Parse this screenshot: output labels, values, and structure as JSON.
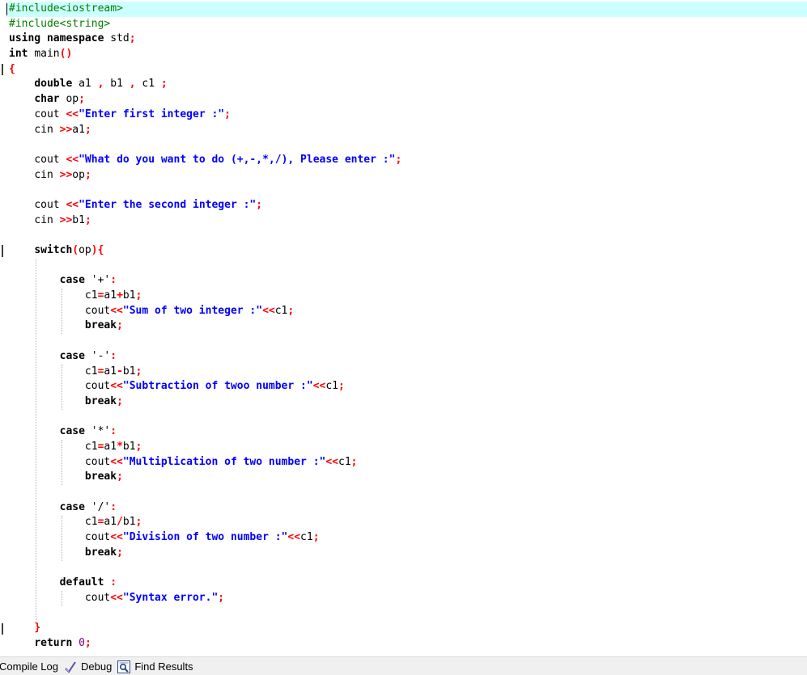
{
  "editor": {
    "lines": [
      [
        [
          "pp",
          "#include<iostream>"
        ]
      ],
      [
        [
          "pp",
          "#include<string>"
        ]
      ],
      [
        [
          "kw",
          "using"
        ],
        [
          "sp",
          " "
        ],
        [
          "kw",
          "namespace"
        ],
        [
          "sp",
          " "
        ],
        [
          "id",
          "std"
        ],
        [
          "sym",
          ";"
        ]
      ],
      [
        [
          "kw",
          "int"
        ],
        [
          "sp",
          " "
        ],
        [
          "id",
          "main"
        ],
        [
          "sym",
          "()"
        ]
      ],
      [
        [
          "sym",
          "{"
        ]
      ],
      [
        [
          "sp",
          "    "
        ],
        [
          "kw",
          "double"
        ],
        [
          "sp",
          " "
        ],
        [
          "id",
          "a1"
        ],
        [
          "sp",
          " "
        ],
        [
          "sym",
          ","
        ],
        [
          "sp",
          " "
        ],
        [
          "id",
          "b1"
        ],
        [
          "sp",
          " "
        ],
        [
          "sym",
          ","
        ],
        [
          "sp",
          " "
        ],
        [
          "id",
          "c1"
        ],
        [
          "sp",
          " "
        ],
        [
          "sym",
          ";"
        ]
      ],
      [
        [
          "sp",
          "    "
        ],
        [
          "kw",
          "char"
        ],
        [
          "sp",
          " "
        ],
        [
          "id",
          "op"
        ],
        [
          "sym",
          ";"
        ]
      ],
      [
        [
          "sp",
          "    "
        ],
        [
          "id",
          "cout"
        ],
        [
          "sp",
          " "
        ],
        [
          "sym",
          "<<"
        ],
        [
          "str",
          "\"Enter first integer :\""
        ],
        [
          "sym",
          ";"
        ]
      ],
      [
        [
          "sp",
          "    "
        ],
        [
          "id",
          "cin"
        ],
        [
          "sp",
          " "
        ],
        [
          "sym",
          ">>"
        ],
        [
          "id",
          "a1"
        ],
        [
          "sym",
          ";"
        ]
      ],
      [],
      [
        [
          "sp",
          "    "
        ],
        [
          "id",
          "cout"
        ],
        [
          "sp",
          " "
        ],
        [
          "sym",
          "<<"
        ],
        [
          "str",
          "\"What do you want to do (+,-,*,/), Please enter :\""
        ],
        [
          "sym",
          ";"
        ]
      ],
      [
        [
          "sp",
          "    "
        ],
        [
          "id",
          "cin"
        ],
        [
          "sp",
          " "
        ],
        [
          "sym",
          ">>"
        ],
        [
          "id",
          "op"
        ],
        [
          "sym",
          ";"
        ]
      ],
      [],
      [
        [
          "sp",
          "    "
        ],
        [
          "id",
          "cout"
        ],
        [
          "sp",
          " "
        ],
        [
          "sym",
          "<<"
        ],
        [
          "str",
          "\"Enter the second integer :\""
        ],
        [
          "sym",
          ";"
        ]
      ],
      [
        [
          "sp",
          "    "
        ],
        [
          "id",
          "cin"
        ],
        [
          "sp",
          " "
        ],
        [
          "sym",
          ">>"
        ],
        [
          "id",
          "b1"
        ],
        [
          "sym",
          ";"
        ]
      ],
      [],
      [
        [
          "sp",
          "    "
        ],
        [
          "kw",
          "switch"
        ],
        [
          "sym",
          "("
        ],
        [
          "id",
          "op"
        ],
        [
          "sym",
          "){"
        ]
      ],
      [],
      [
        [
          "sp",
          "        "
        ],
        [
          "kw",
          "case"
        ],
        [
          "sp",
          " "
        ],
        [
          "id",
          "'+'"
        ],
        [
          "sym",
          ":"
        ]
      ],
      [
        [
          "sp",
          "            "
        ],
        [
          "id",
          "c1"
        ],
        [
          "sym",
          "="
        ],
        [
          "id",
          "a1"
        ],
        [
          "sym",
          "+"
        ],
        [
          "id",
          "b1"
        ],
        [
          "sym",
          ";"
        ]
      ],
      [
        [
          "sp",
          "            "
        ],
        [
          "id",
          "cout"
        ],
        [
          "sym",
          "<<"
        ],
        [
          "str",
          "\"Sum of two integer :\""
        ],
        [
          "sym",
          "<<"
        ],
        [
          "id",
          "c1"
        ],
        [
          "sym",
          ";"
        ]
      ],
      [
        [
          "sp",
          "            "
        ],
        [
          "kw",
          "break"
        ],
        [
          "sym",
          ";"
        ]
      ],
      [],
      [
        [
          "sp",
          "        "
        ],
        [
          "kw",
          "case"
        ],
        [
          "sp",
          " "
        ],
        [
          "id",
          "'-'"
        ],
        [
          "sym",
          ":"
        ]
      ],
      [
        [
          "sp",
          "            "
        ],
        [
          "id",
          "c1"
        ],
        [
          "sym",
          "="
        ],
        [
          "id",
          "a1"
        ],
        [
          "sym",
          "-"
        ],
        [
          "id",
          "b1"
        ],
        [
          "sym",
          ";"
        ]
      ],
      [
        [
          "sp",
          "            "
        ],
        [
          "id",
          "cout"
        ],
        [
          "sym",
          "<<"
        ],
        [
          "str",
          "\"Subtraction of twoo number :\""
        ],
        [
          "sym",
          "<<"
        ],
        [
          "id",
          "c1"
        ],
        [
          "sym",
          ";"
        ]
      ],
      [
        [
          "sp",
          "            "
        ],
        [
          "kw",
          "break"
        ],
        [
          "sym",
          ";"
        ]
      ],
      [],
      [
        [
          "sp",
          "        "
        ],
        [
          "kw",
          "case"
        ],
        [
          "sp",
          " "
        ],
        [
          "id",
          "'*'"
        ],
        [
          "sym",
          ":"
        ]
      ],
      [
        [
          "sp",
          "            "
        ],
        [
          "id",
          "c1"
        ],
        [
          "sym",
          "="
        ],
        [
          "id",
          "a1"
        ],
        [
          "sym",
          "*"
        ],
        [
          "id",
          "b1"
        ],
        [
          "sym",
          ";"
        ]
      ],
      [
        [
          "sp",
          "            "
        ],
        [
          "id",
          "cout"
        ],
        [
          "sym",
          "<<"
        ],
        [
          "str",
          "\"Multiplication of two number :\""
        ],
        [
          "sym",
          "<<"
        ],
        [
          "id",
          "c1"
        ],
        [
          "sym",
          ";"
        ]
      ],
      [
        [
          "sp",
          "            "
        ],
        [
          "kw",
          "break"
        ],
        [
          "sym",
          ";"
        ]
      ],
      [],
      [
        [
          "sp",
          "        "
        ],
        [
          "kw",
          "case"
        ],
        [
          "sp",
          " "
        ],
        [
          "id",
          "'/'"
        ],
        [
          "sym",
          ":"
        ]
      ],
      [
        [
          "sp",
          "            "
        ],
        [
          "id",
          "c1"
        ],
        [
          "sym",
          "="
        ],
        [
          "id",
          "a1"
        ],
        [
          "sym",
          "/"
        ],
        [
          "id",
          "b1"
        ],
        [
          "sym",
          ";"
        ]
      ],
      [
        [
          "sp",
          "            "
        ],
        [
          "id",
          "cout"
        ],
        [
          "sym",
          "<<"
        ],
        [
          "str",
          "\"Division of two number :\""
        ],
        [
          "sym",
          "<<"
        ],
        [
          "id",
          "c1"
        ],
        [
          "sym",
          ";"
        ]
      ],
      [
        [
          "sp",
          "            "
        ],
        [
          "kw",
          "break"
        ],
        [
          "sym",
          ";"
        ]
      ],
      [],
      [
        [
          "sp",
          "        "
        ],
        [
          "kw",
          "default"
        ],
        [
          "sp",
          " "
        ],
        [
          "sym",
          ":"
        ]
      ],
      [
        [
          "sp",
          "            "
        ],
        [
          "id",
          "cout"
        ],
        [
          "sym",
          "<<"
        ],
        [
          "str",
          "\"Syntax error.\""
        ],
        [
          "sym",
          ";"
        ]
      ],
      [],
      [
        [
          "sp",
          "    "
        ],
        [
          "sym",
          "}"
        ]
      ],
      [
        [
          "sp",
          "    "
        ],
        [
          "kw",
          "return"
        ],
        [
          "sp",
          " "
        ],
        [
          "num",
          "0"
        ],
        [
          "sym",
          ";"
        ]
      ]
    ]
  },
  "colors": {
    "preprocessor": "#008000",
    "string": "#0000ff",
    "symbol": "#ff0000",
    "number": "#800080",
    "active_line": "#ccffff"
  },
  "bottom_tabs": [
    {
      "label": "Compile Log",
      "icon": "compile-log-icon"
    },
    {
      "label": "Debug",
      "icon": "debug-check-icon"
    },
    {
      "label": "Find Results",
      "icon": "find-results-icon"
    }
  ]
}
